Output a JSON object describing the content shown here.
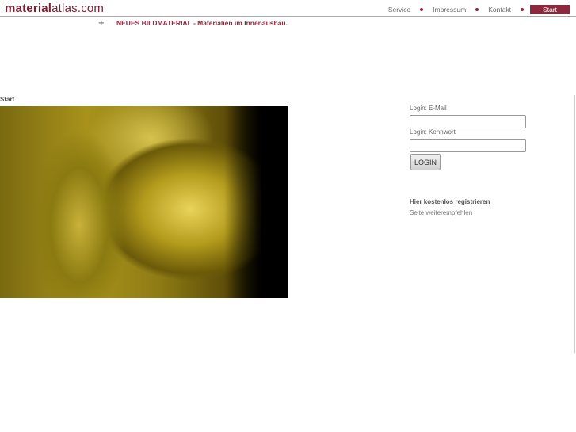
{
  "header": {
    "logo_bold": "material",
    "logo_rest": "atlas.com",
    "nav": [
      "Service",
      "Impressum",
      "Kontakt",
      "Start"
    ]
  },
  "news": {
    "icon": "plus-icon",
    "text": "NEUES BILDMATERIAL - Materialien im Innenausbau."
  },
  "breadcrumb": "Start",
  "login": {
    "email_label": "Login: E-Mail",
    "email_value": "",
    "password_label": "Login: Kennwort",
    "password_value": "",
    "button": "LOGIN"
  },
  "links": {
    "register": "Hier kostenlos registrieren",
    "recommend": "Seite weiterempfehlen"
  }
}
